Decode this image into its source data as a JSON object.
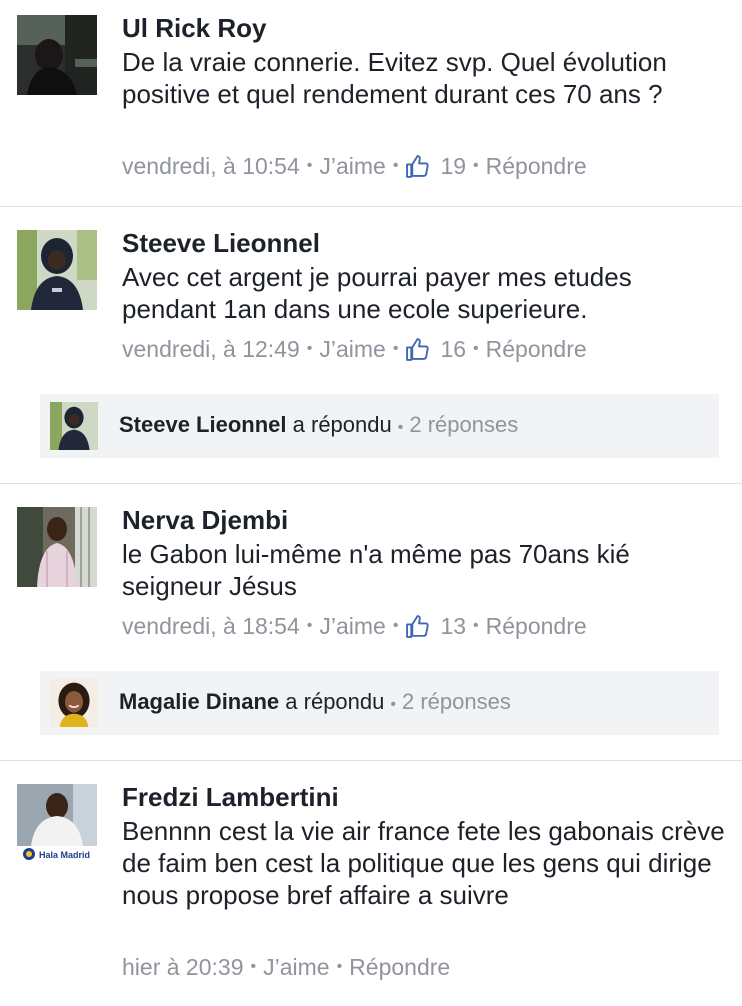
{
  "comments": [
    {
      "author": "Ul Rick Roy",
      "text": "De la vraie connerie. Evitez svp. Quel évolution positive et quel rendement durant ces 70 ans ?",
      "time": "vendredi, à 10:54",
      "like_label": "J’aime",
      "like_count": "19",
      "reply_label": "Répondre"
    },
    {
      "author": "Steeve Lieonnel",
      "text": "Avec cet argent je pourrai payer mes etudes pendant 1an dans une ecole superieure.",
      "time": "vendredi, à 12:49",
      "like_label": "J’aime",
      "like_count": "16",
      "reply_label": "Répondre",
      "reply_summary": {
        "author": "Steeve Lieonnel",
        "action": "a répondu",
        "count": "2 réponses"
      }
    },
    {
      "author": "Nerva Djembi",
      "text": "le Gabon lui-même n'a même pas 70ans kié seigneur Jésus",
      "time": "vendredi, à 18:54",
      "like_label": "J’aime",
      "like_count": "13",
      "reply_label": "Répondre",
      "reply_summary": {
        "author": "Magalie Dinane",
        "action": "a répondu",
        "count": "2 réponses"
      }
    },
    {
      "author": "Fredzi Lambertini",
      "avatar_badge": "Hala Madrid",
      "text": "Bennnn cest la vie air france fete les gabonais crève de faim ben cest la politique que les gens qui dirige nous propose bref affaire a suivre",
      "time": "hier à 20:39",
      "like_label": "J’aime",
      "reply_label": "Répondre"
    }
  ],
  "colors": {
    "text": "#1d2129",
    "meta": "#90949c",
    "like_blue": "#4267b2",
    "reply_bg": "#f2f3f5",
    "divider": "#dddfe2"
  },
  "icons": {
    "like": "thumbs-up-icon"
  }
}
